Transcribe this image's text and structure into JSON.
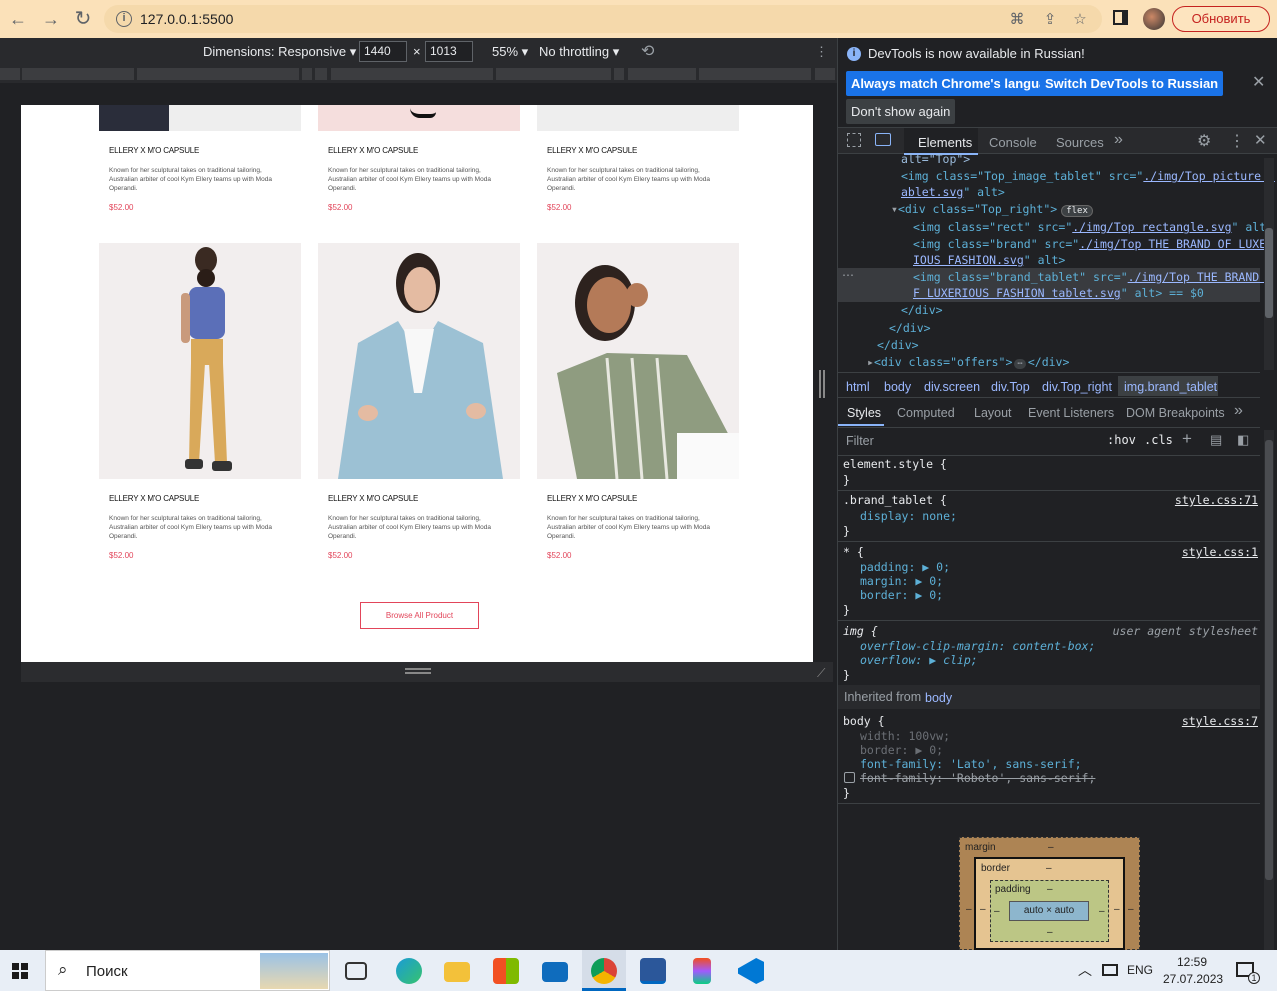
{
  "browser": {
    "url": "127.0.0.1:5500",
    "update_label": "Обновить"
  },
  "device_toolbar": {
    "dimensions_label": "Dimensions: Responsive",
    "width": "1440",
    "times": "×",
    "height": "1013",
    "zoom": "55%",
    "throttle": "No throttling"
  },
  "page": {
    "products_top": [
      {
        "title": "ELLERY X M'O CAPSULE",
        "desc": "Known for her sculptural takes on traditional tailoring, Australian arbiter of cool Kym Ellery teams up with Moda Operandi.",
        "price": "$52.00"
      },
      {
        "title": "ELLERY X M'O CAPSULE",
        "desc": "Known for her sculptural takes on traditional tailoring, Australian arbiter of cool Kym Ellery teams up with Moda Operandi.",
        "price": "$52.00"
      },
      {
        "title": "ELLERY X M'O CAPSULE",
        "desc": "Known for her sculptural takes on traditional tailoring, Australian arbiter of cool Kym Ellery teams up with Moda Operandi.",
        "price": "$52.00"
      }
    ],
    "products_bottom": [
      {
        "title": "ELLERY X M'O CAPSULE",
        "desc": "Known for her sculptural takes on traditional tailoring, Australian arbiter of cool Kym Ellery teams up with Moda Operandi.",
        "price": "$52.00"
      },
      {
        "title": "ELLERY X M'O CAPSULE",
        "desc": "Known for her sculptural takes on traditional tailoring, Australian arbiter of cool Kym Ellery teams up with Moda Operandi.",
        "price": "$52.00"
      },
      {
        "title": "ELLERY X M'O CAPSULE",
        "desc": "Known for her sculptural takes on traditional tailoring, Australian arbiter of cool Kym Ellery teams up with Moda Operandi.",
        "price": "$52.00"
      }
    ],
    "browse_label": "Browse All Product"
  },
  "devtools": {
    "notice": "DevTools is now available in Russian!",
    "btn_match": "Always match Chrome's language",
    "btn_switch": "Switch DevTools to Russian",
    "btn_dont": "Don't show again",
    "tabs": [
      "Elements",
      "Console",
      "Sources"
    ],
    "code": {
      "l0": "alt=\"Top\">",
      "l1a": "<img class=\"Top_image_tablet\" src=\"",
      "l1b": "./img/Top picture t",
      "l2a": "ablet.svg",
      "l2b": "\" alt>",
      "l3": "<div class=\"Top_right\">",
      "l3flex": "flex",
      "l4a": "<img class=\"rect\" src=\"",
      "l4b": "./img/Top rectangle.svg",
      "l4c": "\" alt>",
      "l5a": "<img class=\"brand\" src=\"",
      "l5b": "./img/Top THE BRAND OF LUXER",
      "l6a": "IOUS FASHION.svg",
      "l6b": "\" alt>",
      "l7a": "<img class=\"brand_tablet\" src=\"",
      "l7b": "./img/Top THE BRAND O",
      "l8a": "F LUXERIOUS FASHION tablet.svg",
      "l8b": "\" alt> == $0",
      "l9": "</div>",
      "l10": "</div>",
      "l11": "</div>",
      "l12": "<div class=\"offers\">",
      "l12b": "</div>"
    },
    "breadcrumbs": [
      "html",
      "body",
      "div.screen",
      "div.Top",
      "div.Top_right",
      "img.brand_tablet"
    ],
    "style_tabs": [
      "Styles",
      "Computed",
      "Layout",
      "Event Listeners",
      "DOM Breakpoints"
    ],
    "filter_placeholder": "Filter",
    "hov": ":hov",
    "cls": ".cls",
    "rules": {
      "r0": "element.style {",
      "r0e": "}",
      "r1": ".brand_tablet {",
      "r1src": "style.css:71",
      "r1p": "display: none;",
      "r1e": "}",
      "r2": "* {",
      "r2src": "style.css:1",
      "r2p1": "padding: ▶ 0;",
      "r2p2": "margin: ▶ 0;",
      "r2p3": "border: ▶ 0;",
      "r2e": "}",
      "r3": "img {",
      "r3src": "user agent stylesheet",
      "r3p1": "overflow-clip-margin: content-box;",
      "r3p2": "overflow: ▶ clip;",
      "r3e": "}",
      "inherited": "Inherited from",
      "inherited_from": "body",
      "r4": "body {",
      "r4src": "style.css:7",
      "r4p1": "width: 100vw;",
      "r4p2": "border: ▶ 0;",
      "r4p3": "font-family: 'Lato', sans-serif;",
      "r4p4": "font-family: 'Roboto', sans-serif;",
      "r4e": "}"
    },
    "boxmodel": {
      "margin": "margin",
      "border": "border",
      "padding": "padding",
      "content": "auto × auto",
      "dash": "–"
    }
  },
  "taskbar": {
    "search": "Поиск",
    "lang": "ENG",
    "time": "12:59",
    "date": "27.07.2023",
    "notif": "1"
  }
}
